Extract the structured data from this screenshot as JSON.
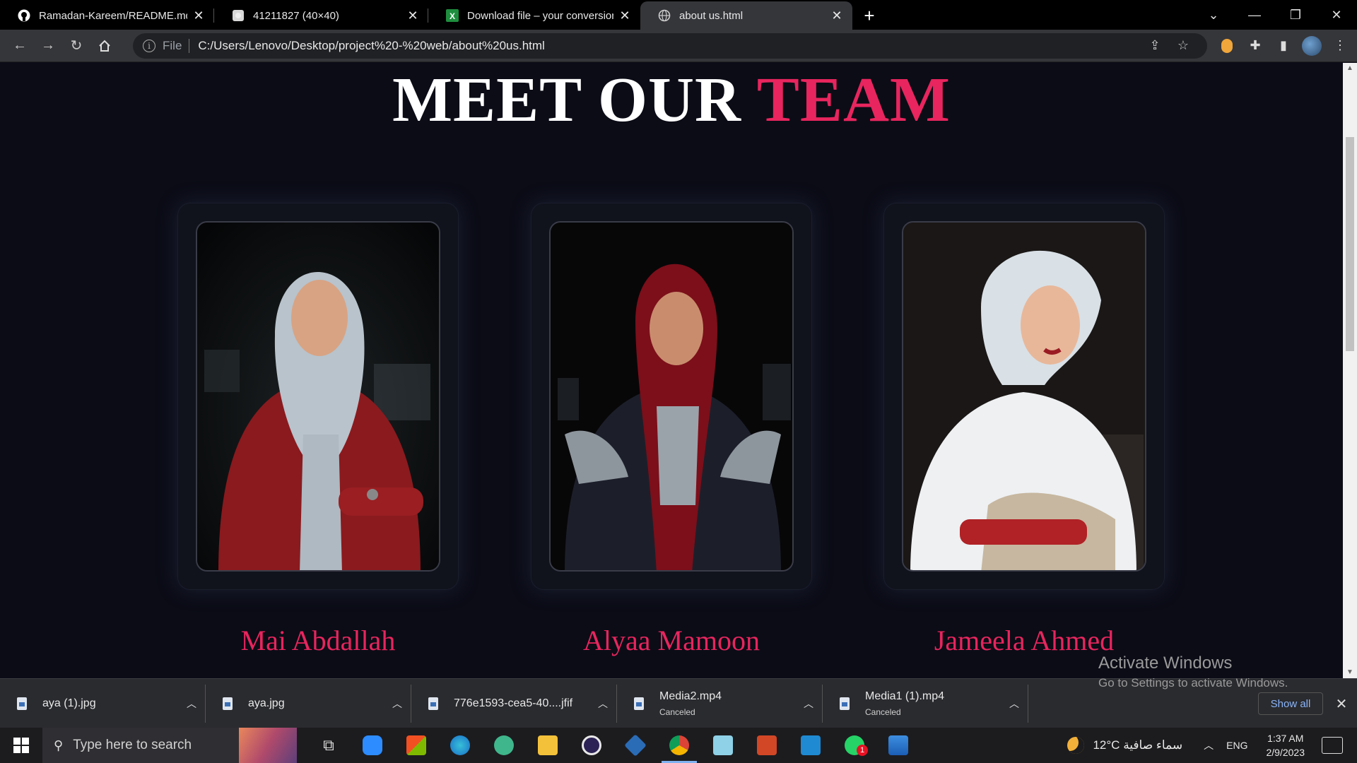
{
  "browser": {
    "tabs": [
      {
        "title": "Ramadan-Kareem/README.md a",
        "icon": "github-icon",
        "active": false
      },
      {
        "title": "41211827 (40×40)",
        "icon": "image-icon",
        "active": false
      },
      {
        "title": "Download file – your conversion",
        "icon": "excel-icon",
        "active": false
      },
      {
        "title": "about us.html",
        "icon": "globe-icon",
        "active": true
      }
    ],
    "new_tab": "+",
    "address": {
      "scheme": "File",
      "url": "C:/Users/Lenovo/Desktop/project%20-%20web/about%20us.html"
    }
  },
  "page": {
    "heading_part1": "MEET OUR ",
    "heading_part2": "TEAM",
    "accent_color": "#e8255e",
    "members": [
      {
        "name": "Mai Abdallah",
        "photo_colors": [
          "#8a1a1e",
          "#b8c3cc"
        ]
      },
      {
        "name": "Alyaa Mamoon",
        "photo_colors": [
          "#7c0f1a",
          "#9aa3aa"
        ]
      },
      {
        "name": "Jameela Ahmed",
        "photo_colors": [
          "#eef0f2",
          "#c7b7a0"
        ]
      }
    ]
  },
  "downloads": {
    "items": [
      {
        "name": "aya (1).jpg",
        "status": ""
      },
      {
        "name": "aya.jpg",
        "status": ""
      },
      {
        "name": "776e1593-cea5-40....jfif",
        "status": ""
      },
      {
        "name": "Media2.mp4",
        "status": "Canceled"
      },
      {
        "name": "Media1 (1).mp4",
        "status": "Canceled"
      }
    ],
    "show_all": "Show all"
  },
  "watermark": {
    "line1": "Activate Windows",
    "line2": "Go to Settings to activate Windows."
  },
  "taskbar": {
    "search_placeholder": "Type here to search",
    "weather": "12°C  سماء صافية",
    "language": "ENG",
    "time": "1:37 AM",
    "date": "2/9/2023",
    "whatsapp_badge": "1"
  }
}
